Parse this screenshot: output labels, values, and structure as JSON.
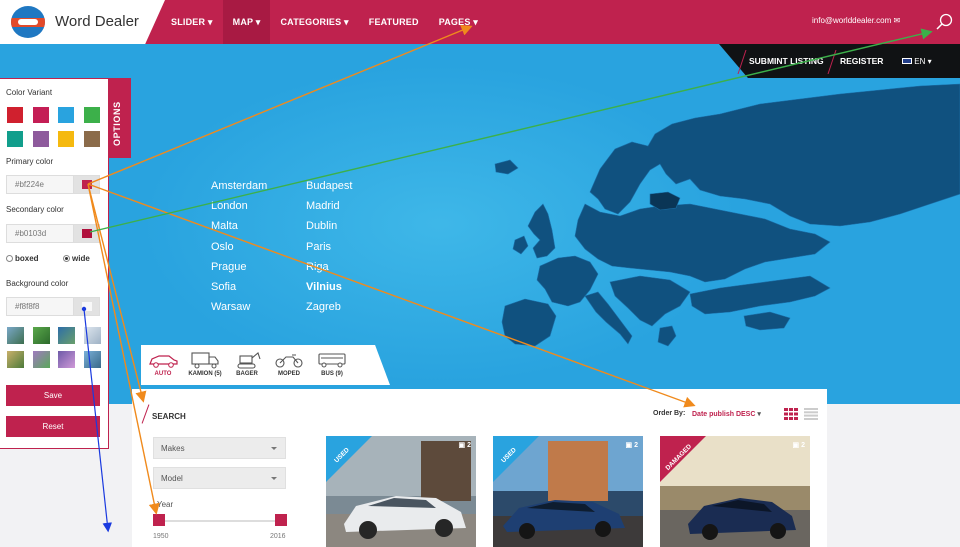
{
  "brand": {
    "name": "Word Dealer"
  },
  "nav": {
    "items": [
      {
        "label": "SLIDER",
        "caret": true
      },
      {
        "label": "MAP",
        "caret": true
      },
      {
        "label": "CATEGORIES",
        "caret": true
      },
      {
        "label": "FEATURED",
        "caret": false
      },
      {
        "label": "PAGES",
        "caret": true
      }
    ],
    "email": "info@worlddealer.com"
  },
  "subnav": {
    "submit": "SUBMINT LISTING",
    "register": "REGISTER",
    "language": "EN"
  },
  "cities": {
    "col1": [
      "Amsterdam",
      "London",
      "Malta",
      "Oslo",
      "Prague",
      "Sofia",
      "Warsaw"
    ],
    "col2": [
      "Budapest",
      "Madrid",
      "Dublin",
      "Paris",
      "Riga",
      "Vilnius",
      "Zagreb"
    ],
    "highlighted": "Vilnius"
  },
  "options": {
    "tab_label": "OPTIONS",
    "color_variant_label": "Color Variant",
    "swatches": [
      "#d0202e",
      "#c41e55",
      "#29a3df",
      "#3cb04a",
      "#119e8c",
      "#8e5a9c",
      "#f5b90f",
      "#8b6b4a"
    ],
    "primary_label": "Primary color",
    "primary_value": "#bf224e",
    "secondary_label": "Secondary color",
    "secondary_value": "#b0103d",
    "layout_boxed": "boxed",
    "layout_wide": "wide",
    "background_label": "Background color",
    "background_value": "#f8f8f8",
    "save": "Save",
    "reset": "Reset"
  },
  "vehicle_tabs": [
    {
      "label": "AUTO",
      "active": true
    },
    {
      "label": "KAMION (5)",
      "active": false
    },
    {
      "label": "BAGER",
      "active": false
    },
    {
      "label": "MOPED",
      "active": false
    },
    {
      "label": "BUS (9)",
      "active": false
    }
  ],
  "search": {
    "title": "SEARCH",
    "order_label": "Order By:",
    "order_value": "Date publish DESC",
    "makes": "Makes",
    "model": "Model",
    "year_label": "Year",
    "year_min": "1950",
    "year_max": "2016"
  },
  "listings": [
    {
      "badge": "USED",
      "photos": "2"
    },
    {
      "badge": "USED",
      "photos": "2"
    },
    {
      "badge": "DAMAGED",
      "photos": "2"
    }
  ],
  "colors": {
    "primary": "#bf224e",
    "hero": "#29a3df",
    "map": "#10517f"
  }
}
